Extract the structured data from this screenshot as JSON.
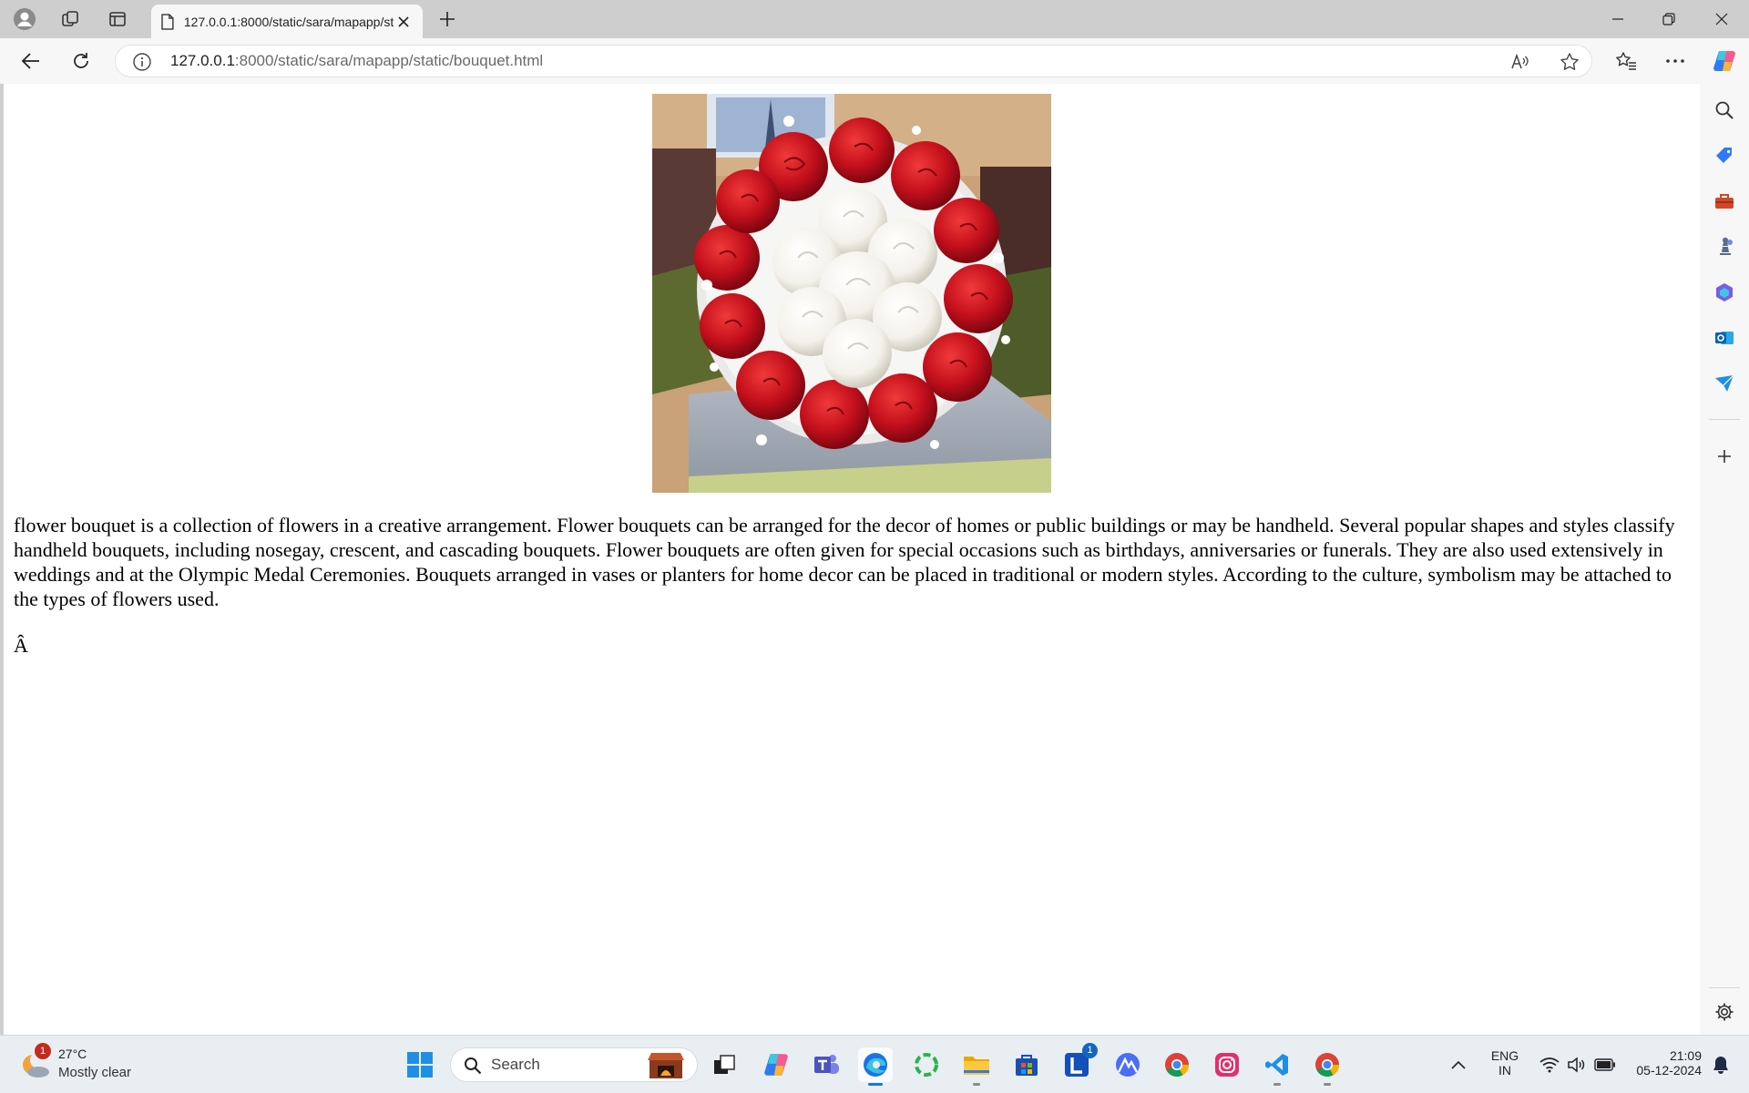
{
  "browser": {
    "tab_title": "127.0.0.1:8000/static/sara/mapapp/static/bouquet.html",
    "address_host": "127.0.0.1",
    "address_path": ":8000/static/sara/mapapp/static/bouquet.html"
  },
  "page": {
    "image_alt": "flower bouquet of red roses and white roses",
    "paragraph": "flower bouquet is a collection of flowers in a creative arrangement. Flower bouquets can be arranged for the decor of homes or public buildings or may be handheld. Several popular shapes and styles classify handheld bouquets, including nosegay, crescent, and cascading bouquets. Flower bouquets are often given for special occasions such as birthdays, anniversaries or funerals. They are also used extensively in weddings and at the Olympic Medal Ceremonies. Bouquets arranged in vases or planters for home decor can be placed in traditional or modern styles. According to the culture, symbolism may be attached to the types of flowers used.",
    "stray_char": "Â"
  },
  "taskbar": {
    "weather_temp": "27°C",
    "weather_condition": "Mostly clear",
    "weather_badge": "1",
    "search_label": "Search",
    "lens_badge": "1",
    "lang_top": "ENG",
    "lang_bottom": "IN",
    "time": "21:09",
    "date": "05-12-2024"
  },
  "colors": {
    "edge_blue": "#1a73e8",
    "rose_red": "#c4101c",
    "notification_red": "#c42b1c"
  }
}
